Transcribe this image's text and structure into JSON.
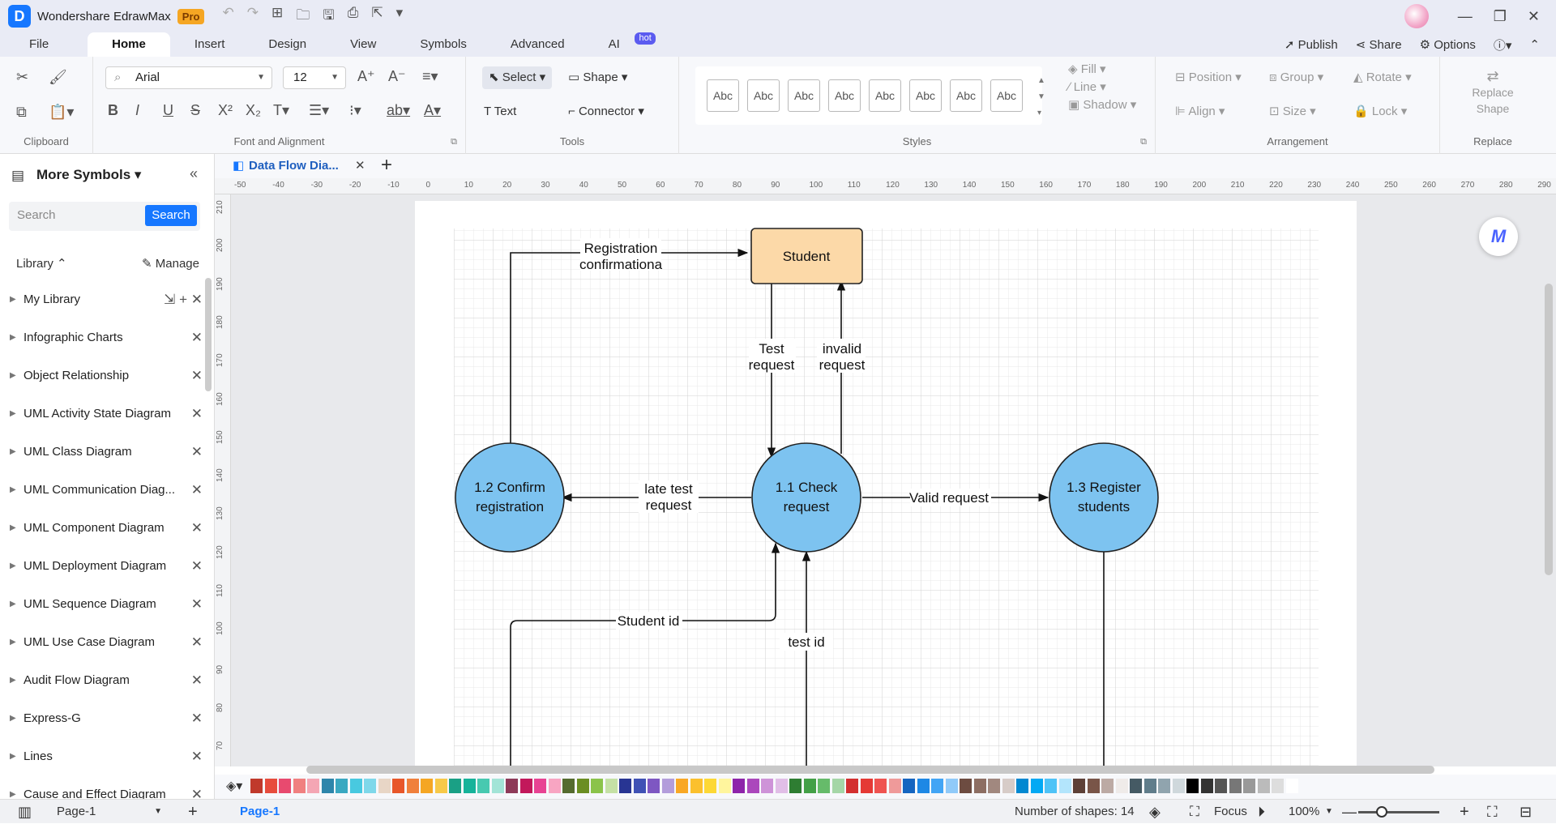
{
  "app": {
    "title": "Wondershare EdrawMax",
    "badge": "Pro"
  },
  "menu": {
    "items": [
      "File",
      "Home",
      "Insert",
      "Design",
      "View",
      "Symbols",
      "Advanced",
      "AI"
    ],
    "active": "Home",
    "ai_badge": "hot",
    "right": {
      "publish": "Publish",
      "share": "Share",
      "options": "Options"
    }
  },
  "ribbon": {
    "groups": {
      "clipboard": "Clipboard",
      "font": "Font and Alignment",
      "tools": "Tools",
      "styles": "Styles",
      "arrangement": "Arrangement",
      "replace": "Replace"
    },
    "font_name": "Arial",
    "font_size": "12",
    "select": "Select",
    "shape": "Shape",
    "text": "Text",
    "connector": "Connector",
    "style_samples": [
      "Abc",
      "Abc",
      "Abc",
      "Abc",
      "Abc",
      "Abc",
      "Abc",
      "Abc"
    ],
    "fill": "Fill",
    "line": "Line",
    "shadow": "Shadow",
    "position": "Position",
    "group": "Group",
    "rotate": "Rotate",
    "align": "Align",
    "size": "Size",
    "lock": "Lock",
    "replace_shape": [
      "Replace",
      "Shape"
    ]
  },
  "left_panel": {
    "title": "More Symbols",
    "search_placeholder": "Search",
    "search_button": "Search",
    "library": "Library",
    "manage": "Manage",
    "items": [
      "My Library",
      "Infographic Charts",
      "Object Relationship",
      "UML Activity State Diagram",
      "UML Class Diagram",
      "UML Communication Diag...",
      "UML Component Diagram",
      "UML Deployment Diagram",
      "UML Sequence Diagram",
      "UML Use Case Diagram",
      "Audit Flow Diagram",
      "Express-G",
      "Lines",
      "Cause and Effect Diagram"
    ]
  },
  "doc_tab": {
    "label": "Data Flow Dia..."
  },
  "ruler": {
    "h": [
      "-50",
      "-40",
      "-30",
      "-20",
      "-10",
      "0",
      "10",
      "20",
      "30",
      "40",
      "50",
      "60",
      "70",
      "80",
      "90",
      "100",
      "110",
      "120",
      "130",
      "140",
      "150",
      "160",
      "170",
      "180",
      "190",
      "200",
      "210",
      "220",
      "230",
      "240",
      "250",
      "260",
      "270",
      "280",
      "290"
    ],
    "v": [
      "210",
      "200",
      "190",
      "180",
      "170",
      "160",
      "150",
      "140",
      "130",
      "120",
      "110",
      "100",
      "90",
      "80",
      "70"
    ]
  },
  "diagram": {
    "student": "Student",
    "check": [
      "1.1 Check",
      "request"
    ],
    "confirm": [
      "1.2 Confirm",
      "registration"
    ],
    "register": [
      "1.3 Register",
      "students"
    ],
    "reg_conf": [
      "Registration",
      "confirmationa"
    ],
    "test_req": [
      "Test",
      "request"
    ],
    "invalid_req": [
      "invalid",
      "request"
    ],
    "late_req": [
      "late test",
      "request"
    ],
    "valid_req": "Valid request",
    "student_id": "Student id",
    "test_id": "test id",
    "colors": {
      "entity": "#fcd9a8",
      "process": "#7dc3f0"
    }
  },
  "status": {
    "page_select": "Page-1",
    "page_tab": "Page-1",
    "shapes": "Number of shapes: 14",
    "focus": "Focus",
    "zoom": "100%"
  }
}
